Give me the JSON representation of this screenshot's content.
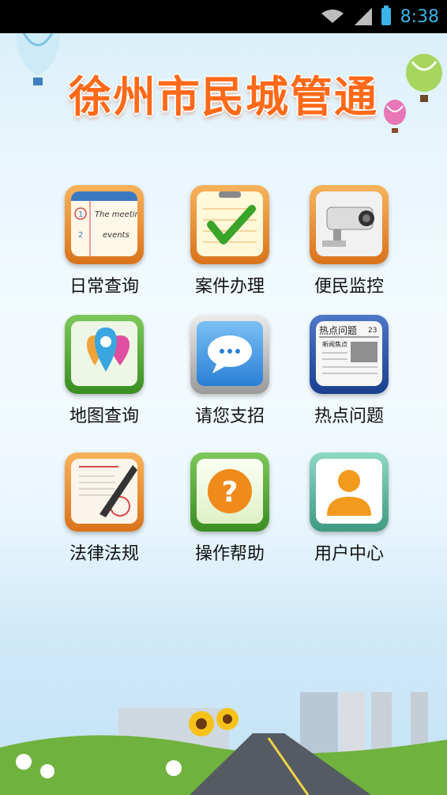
{
  "status": {
    "time": "8:38"
  },
  "app": {
    "title": "徐州市民城管通"
  },
  "menu": [
    {
      "label": "日常查询"
    },
    {
      "label": "案件办理"
    },
    {
      "label": "便民监控"
    },
    {
      "label": "地图查询"
    },
    {
      "label": "请您支招"
    },
    {
      "label": "热点问题"
    },
    {
      "label": "法律法规"
    },
    {
      "label": "操作帮助"
    },
    {
      "label": "用户中心"
    }
  ],
  "icons": {
    "daily-note": {
      "line1": "The meeting",
      "line2": "events",
      "num1": "1",
      "num2": "2"
    },
    "hot-news": {
      "header": "热点问题",
      "sub": "新闻焦点",
      "num": "23"
    },
    "help": {
      "glyph": "?"
    }
  },
  "colors": {
    "status_time": "#3ab3e6",
    "title": "#ff6a1a"
  }
}
